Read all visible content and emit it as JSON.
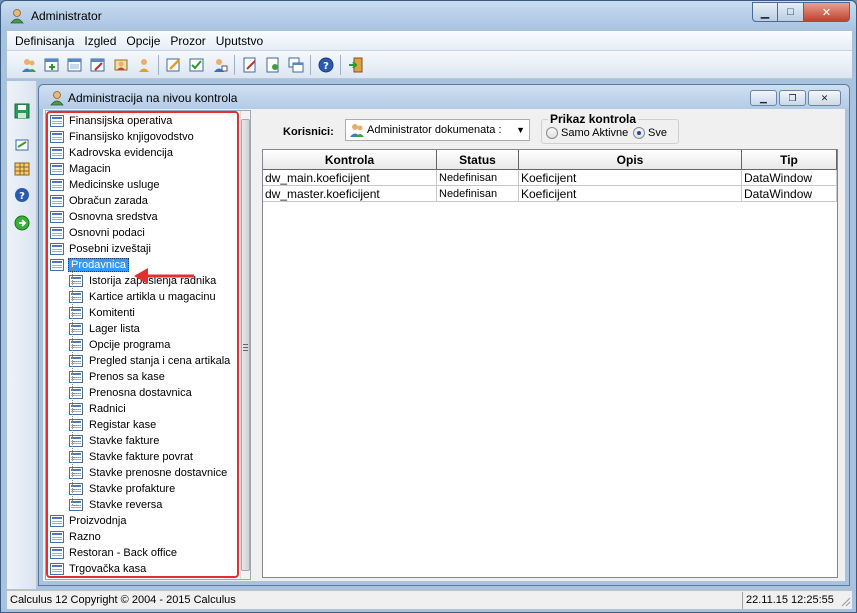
{
  "window": {
    "title": "Administrator"
  },
  "menu": [
    "Definisanja",
    "Izgled",
    "Opcije",
    "Prozor",
    "Uputstvo"
  ],
  "toolbar_icons": [
    "users-icon",
    "add-window-icon",
    "window-icon",
    "window-edit-icon",
    "users-group-icon",
    "user-key-icon",
    "edit-icon",
    "checklist-icon",
    "user-edit-icon",
    "document-edit-icon",
    "document-gear-icon",
    "copy-window-icon",
    "help-icon",
    "exit-icon"
  ],
  "leftbar_icons": [
    "save-icon",
    "refresh-icon",
    "grid-icon",
    "help-icon",
    "go-icon"
  ],
  "child": {
    "title": "Administracija na nivou kontrola"
  },
  "tree": {
    "top_items_before": [
      "Finansijska operativa",
      "Finansijsko knjigovodstvo",
      "Kadrovska evidencija",
      "Magacin",
      "Medicinske usluge",
      "Obračun zarada",
      "Osnovna sredstva",
      "Osnovni podaci",
      "Posebni izveštaji"
    ],
    "selected": "Prodavnica",
    "children": [
      "Istorija zaposlenja radnika",
      "Kartice artikla u magacinu",
      "Komitenti",
      "Lager lista",
      "Opcije programa",
      "Pregled stanja i cena artikala",
      "Prenos sa kase",
      "Prenosna dostavnica",
      "Radnici",
      "Registar kase",
      "Stavke fakture",
      "Stavke fakture povrat",
      "Stavke prenosne dostavnice",
      "Stavke profakture",
      "Stavke reversa"
    ],
    "top_items_after": [
      "Proizvodnja",
      "Razno",
      "Restoran - Back office",
      "Trgovačka kasa"
    ]
  },
  "filter": {
    "korisnici_label": "Korisnici:",
    "korisnici_value": "Administrator dokumenata :",
    "prikaz_label": "Prikaz kontrola",
    "option_active": "Samo Aktivne",
    "option_all": "Sve",
    "selected_option": "Sve"
  },
  "grid": {
    "columns": [
      "Kontrola",
      "Status",
      "Opis",
      "Tip"
    ],
    "rows": [
      [
        "dw_main.koeficijent",
        "Nedefinisan",
        "Koeficijent",
        "DataWindow"
      ],
      [
        "dw_master.koeficijent",
        "Nedefinisan",
        "Koeficijent",
        "DataWindow"
      ]
    ]
  },
  "status": {
    "left": "Calculus 12  Copyright © 2004 - 2015  Calculus",
    "right": "22.11.15 12:25:55"
  },
  "colors": {
    "highlight_border": "#e03030",
    "selection": "#3399ff"
  }
}
